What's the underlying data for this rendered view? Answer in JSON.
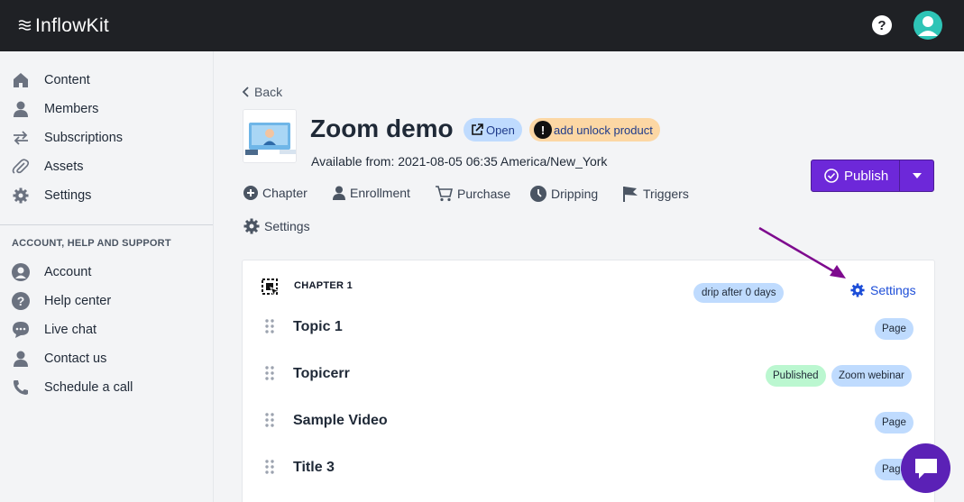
{
  "app": {
    "name": "InflowKit"
  },
  "topbar": {
    "help_icon": "question-circle-icon",
    "avatar_icon": "user-avatar-icon"
  },
  "sidebar": {
    "items": [
      {
        "label": "Content",
        "icon": "home-icon"
      },
      {
        "label": "Members",
        "icon": "user-icon"
      },
      {
        "label": "Subscriptions",
        "icon": "swap-arrows-icon"
      },
      {
        "label": "Assets",
        "icon": "paperclip-icon"
      },
      {
        "label": "Settings",
        "icon": "gear-icon"
      }
    ],
    "section_title": "ACCOUNT, HELP AND SUPPORT",
    "support_items": [
      {
        "label": "Account",
        "icon": "user-circle-icon"
      },
      {
        "label": "Help center",
        "icon": "question-circle-icon"
      },
      {
        "label": "Live chat",
        "icon": "chat-icon"
      },
      {
        "label": "Contact us",
        "icon": "user-icon"
      },
      {
        "label": "Schedule a call",
        "icon": "phone-icon"
      }
    ]
  },
  "main": {
    "back_label": "Back",
    "course_title": "Zoom demo",
    "open_label": "Open",
    "unlock_icon_text": "!",
    "unlock_label": "add unlock product",
    "available_from": "Available from: 2021-08-05 06:35 America/New_York",
    "publish_label": "Publish",
    "tabs": [
      {
        "label": "Chapter",
        "icon": "plus-circle-icon"
      },
      {
        "label": "Enrollment",
        "icon": "user-icon"
      },
      {
        "label": "Purchase",
        "icon": "cart-icon"
      },
      {
        "label": "Dripping",
        "icon": "clock-icon"
      },
      {
        "label": "Triggers",
        "icon": "flag-icon"
      },
      {
        "label": "Settings",
        "icon": "gear-icon"
      }
    ],
    "chapter": {
      "label": "CHAPTER 1",
      "drip": "drip after 0 days",
      "settings_label": "Settings",
      "topics": [
        {
          "name": "Topic 1",
          "tags": [
            "Page"
          ]
        },
        {
          "name": "Topicerr",
          "tags": [
            "Published",
            "Zoom webinar"
          ]
        },
        {
          "name": "Sample Video",
          "tags": [
            "Page"
          ]
        },
        {
          "name": "Title 3",
          "tags": [
            "Page"
          ]
        }
      ]
    }
  },
  "colors": {
    "topbar": "#1f2125",
    "accent": "#6d28d9",
    "link": "#1d4ed8",
    "annotation_arrow": "#7e0a8e"
  }
}
